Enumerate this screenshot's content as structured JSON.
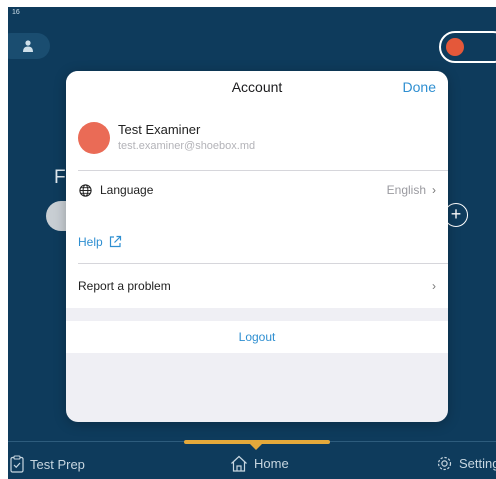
{
  "status_bar": {
    "time": "16"
  },
  "background": {
    "partial_heading": "F"
  },
  "modal": {
    "title": "Account",
    "done_label": "Done",
    "profile": {
      "name": "Test Examiner",
      "email": "test.examiner@shoebox.md"
    },
    "language": {
      "label": "Language",
      "value": "English"
    },
    "help_label": "Help",
    "report_label": "Report a problem",
    "logout_label": "Logout"
  },
  "bottom_nav": {
    "items": [
      {
        "label": "Test Prep",
        "icon": "clipboard-check-icon"
      },
      {
        "label": "Home",
        "icon": "home-icon"
      },
      {
        "label": "Settings",
        "icon": "gear-icon"
      }
    ],
    "active": "Home"
  },
  "colors": {
    "app_background": "#0e3b5c",
    "accent_blue": "#2f8fd1",
    "avatar": "#ea6b56",
    "record_red": "#e4583a",
    "nav_indicator": "#e4a93b"
  }
}
